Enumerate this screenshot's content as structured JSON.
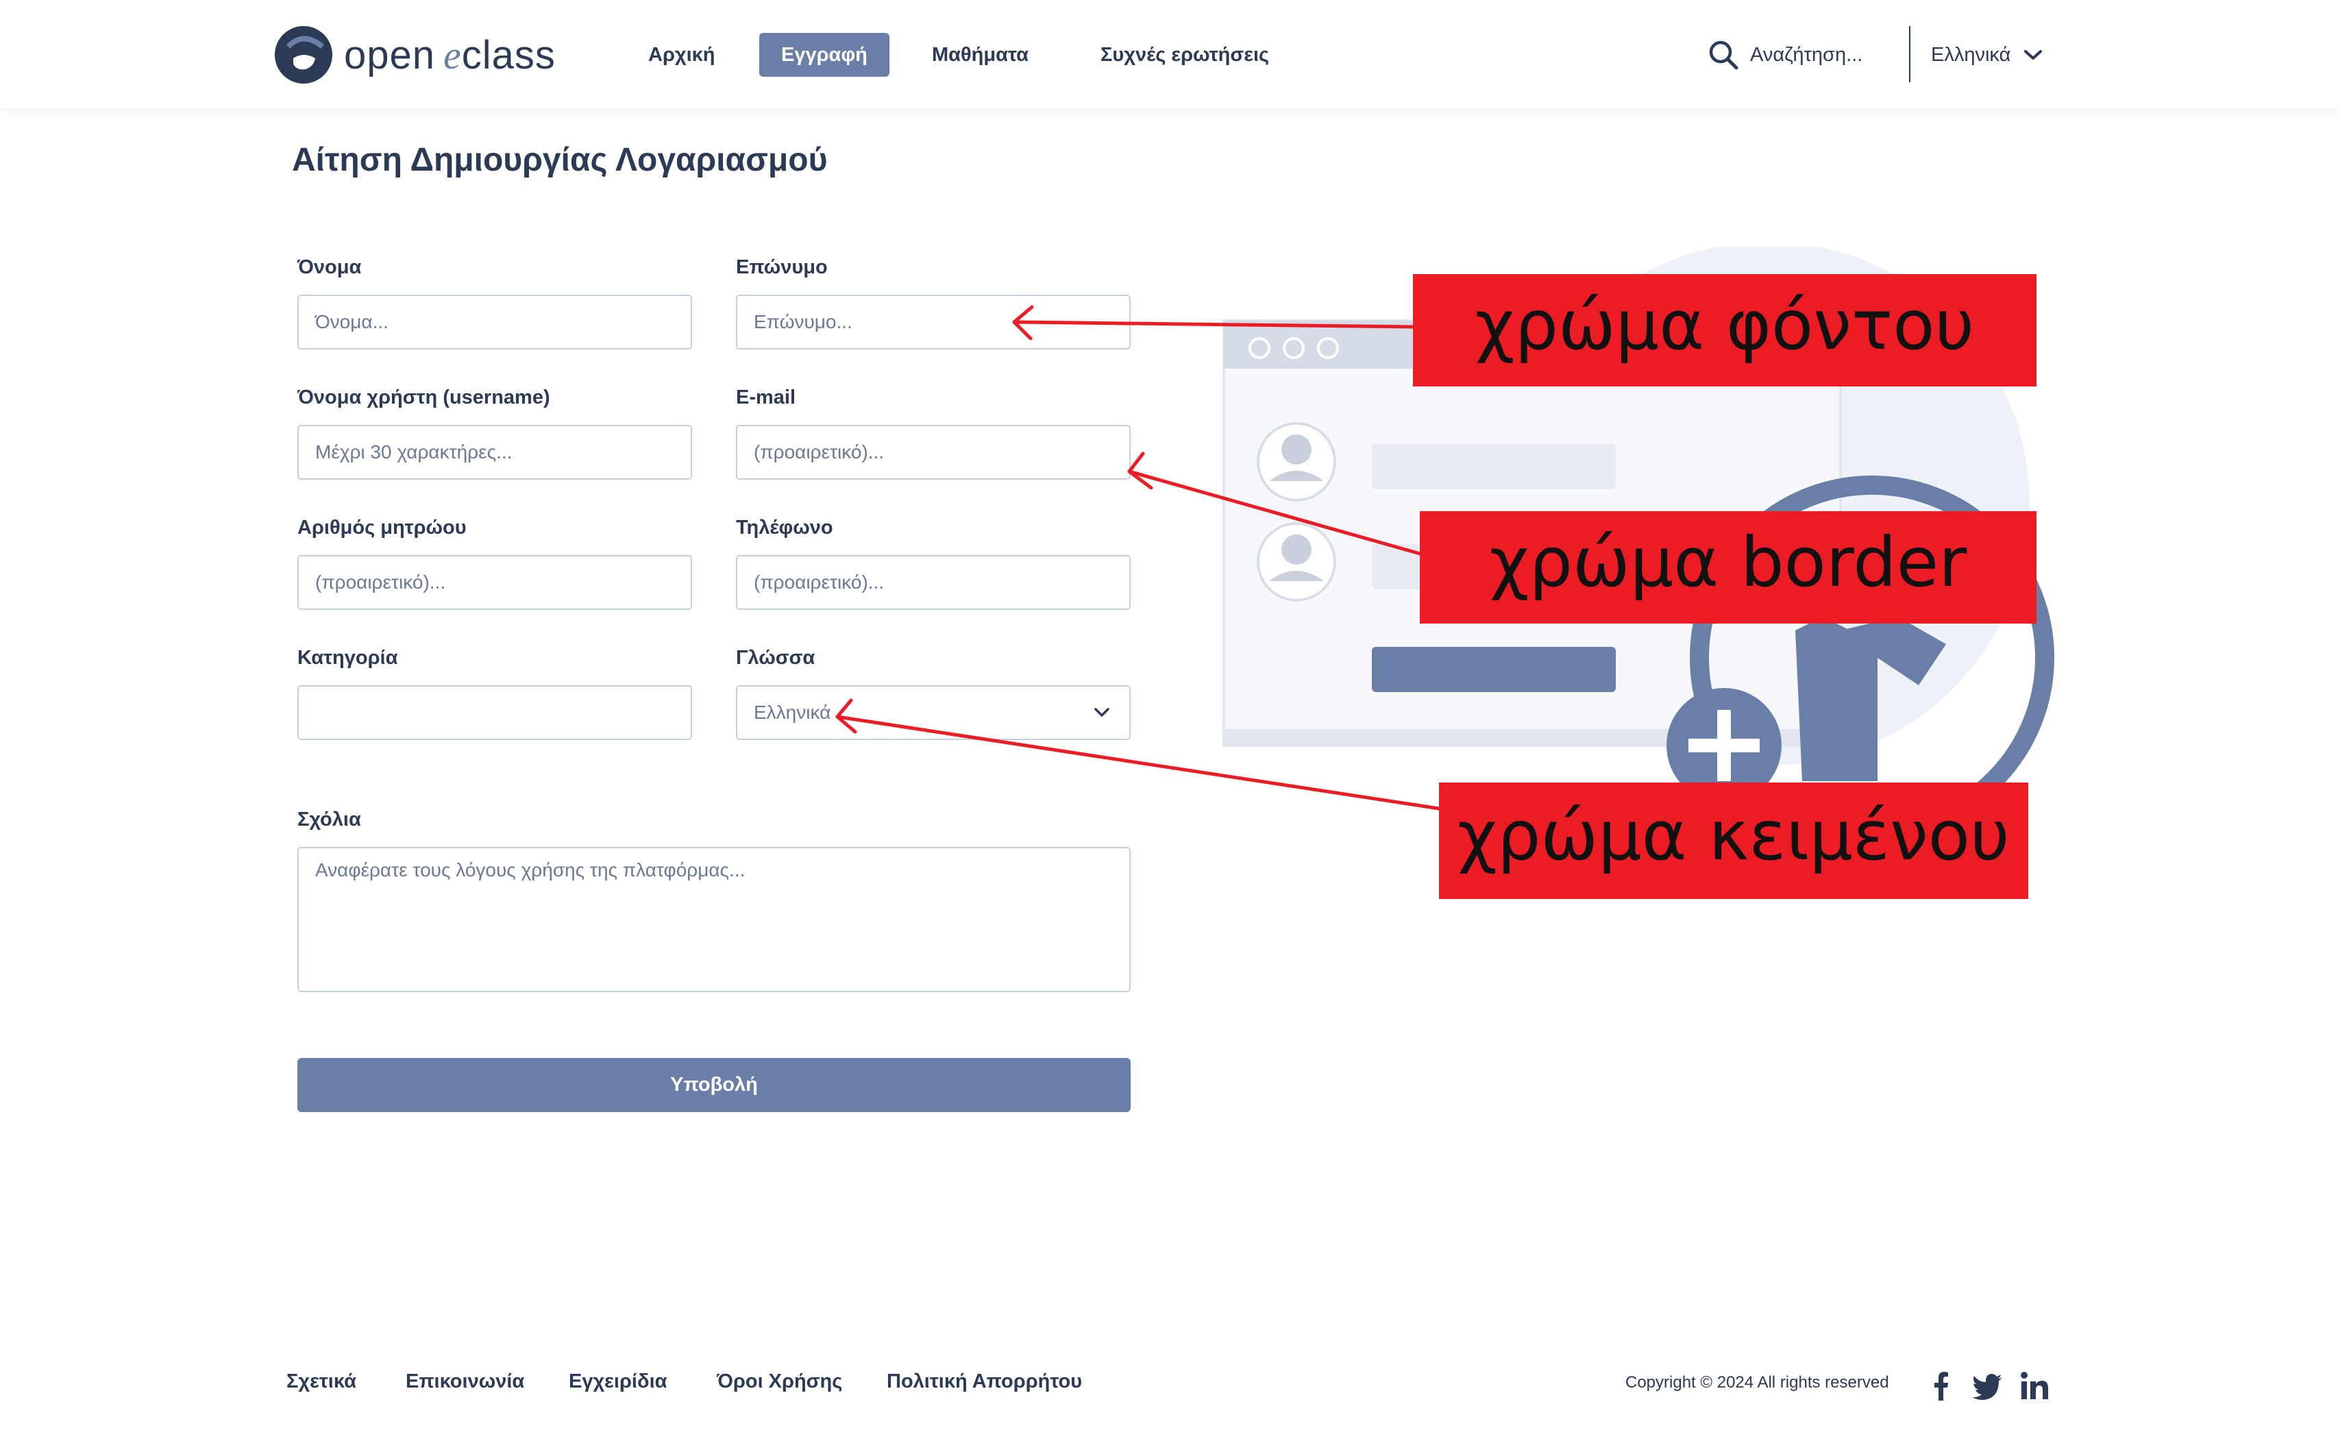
{
  "header": {
    "logo": {
      "word1": "open",
      "word2": "e",
      "word3": "class"
    },
    "nav": [
      {
        "label": "Αρχική",
        "active": false
      },
      {
        "label": "Εγγραφή",
        "active": true
      },
      {
        "label": "Μαθήματα",
        "active": false
      },
      {
        "label": "Συχνές ερωτήσεις",
        "active": false
      }
    ],
    "search_placeholder": "Αναζήτηση...",
    "search_icon": "search-icon",
    "language": "Ελληνικά",
    "language_icon": "chevron-down-icon"
  },
  "form": {
    "title": "Αίτηση Δημιουργίας Λογαριασμού",
    "fields": {
      "first_name": {
        "label": "Όνομα",
        "placeholder": "Όνομα..."
      },
      "last_name": {
        "label": "Επώνυμο",
        "placeholder": "Επώνυμο..."
      },
      "username": {
        "label": "Όνομα χρήστη (username)",
        "placeholder": "Μέχρι 30 χαρακτήρες..."
      },
      "email": {
        "label": "E-mail",
        "placeholder": "(προαιρετικό)..."
      },
      "am": {
        "label": "Αριθμός μητρώου",
        "placeholder": "(προαιρετικό)..."
      },
      "phone": {
        "label": "Τηλέφωνο",
        "placeholder": "(προαιρετικό)..."
      },
      "category": {
        "label": "Κατηγορία",
        "value": ""
      },
      "language": {
        "label": "Γλώσσα",
        "value": "Ελληνικά"
      },
      "comments": {
        "label": "Σχόλια",
        "placeholder": "Αναφέρατε τους λόγους χρήσης της πλατφόρμας..."
      }
    },
    "submit_label": "Υποβολή"
  },
  "annotations": {
    "background": "χρώμα φόντου",
    "border": "χρώμα border",
    "text": "χρώμα κειμένου"
  },
  "footer": {
    "links": [
      "Σχετικά",
      "Επικοινωνία",
      "Εγχειρίδια",
      "Όροι Χρήσης",
      "Πολιτική Απορρήτου"
    ],
    "copyright": "Copyright © 2024 All rights reserved",
    "social": [
      "facebook-icon",
      "twitter-icon",
      "linkedin-icon"
    ]
  },
  "colors": {
    "primary": "#6a7fa8",
    "text": "#2b3a55",
    "border": "#c8cfdc",
    "annotation": "#ec1c24"
  }
}
